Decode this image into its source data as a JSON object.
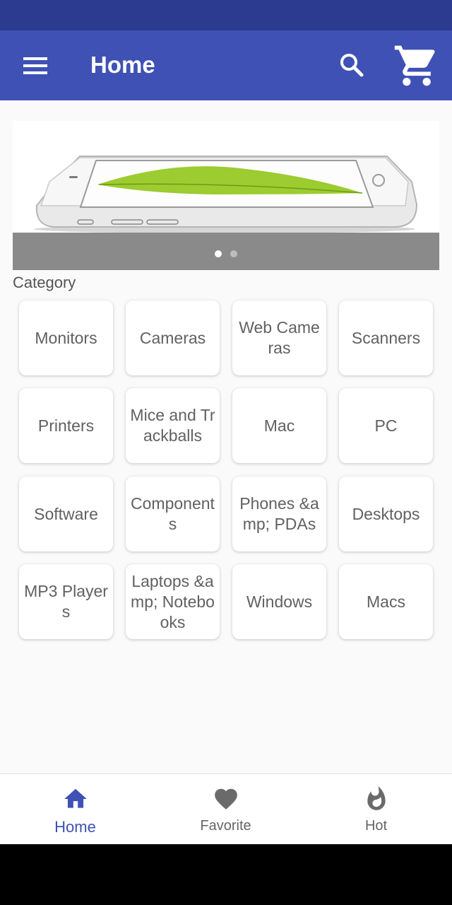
{
  "colors": {
    "primary": "#3f51b5",
    "status_bar": "#2c3a8f",
    "nav_active": "#3f51b5",
    "nav_inactive": "#666666"
  },
  "app_bar": {
    "title": "Home",
    "menu_icon": "menu-icon",
    "search_icon": "search-icon",
    "cart_icon": "cart-icon"
  },
  "banner": {
    "image": "iphone-leaf-image",
    "pages": 2,
    "current_page": 1
  },
  "category": {
    "label": "Category",
    "items": [
      "Monitors",
      "Cameras",
      "Web Cameras",
      "Scanners",
      "Printers",
      "Mice and Trackballs",
      "Mac",
      "PC",
      "Software",
      "Components",
      "Phones &amp; PDAs",
      "Desktops",
      "MP3 Players",
      "Laptops &amp; Notebooks",
      "Windows",
      "Macs"
    ]
  },
  "bottom_nav": {
    "items": [
      {
        "label": "Home",
        "icon": "home-icon",
        "active": true
      },
      {
        "label": "Favorite",
        "icon": "heart-icon",
        "active": false
      },
      {
        "label": "Hot",
        "icon": "flame-icon",
        "active": false
      }
    ]
  }
}
